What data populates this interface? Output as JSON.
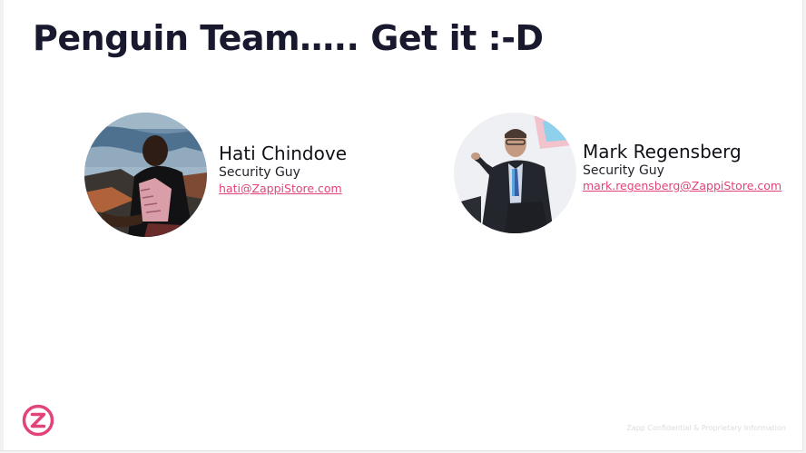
{
  "slide": {
    "title": "Penguin Team….. Get it :-D",
    "footer_text": "Zapp Confidential & Proprietary Information",
    "brand_color": "#e2437a",
    "title_color": "#18182f"
  },
  "people": [
    {
      "name": "Hati Chindove",
      "role": "Security Guy",
      "email": "hati@ZappiStore.com"
    },
    {
      "name": "Mark Regensberg",
      "role": "Security Guy",
      "email": "mark.regensberg@ZappiStore.com"
    }
  ],
  "logo": {
    "icon": "zappi-z-logo",
    "letter": "Z"
  }
}
